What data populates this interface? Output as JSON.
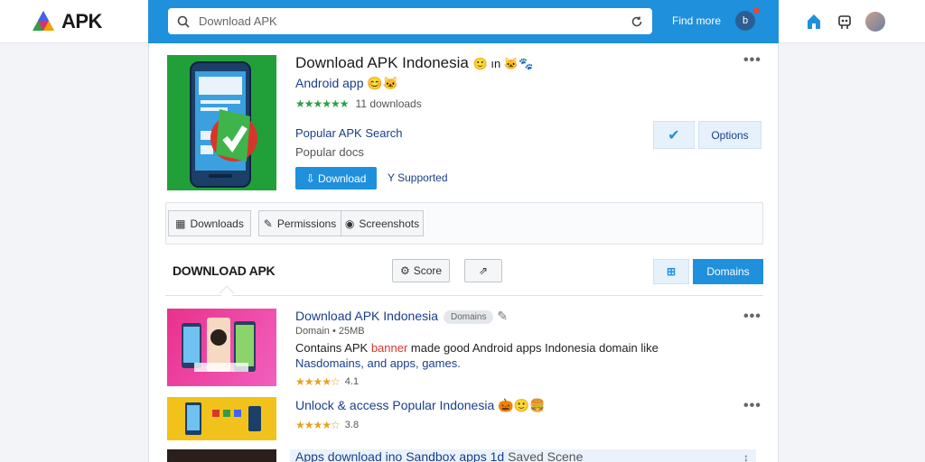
{
  "brand": {
    "name": "APK"
  },
  "search": {
    "placeholder": "Download APK"
  },
  "topbar": {
    "link_label": "Find more",
    "avatar_initial": "b"
  },
  "hero": {
    "title": "Download APK Indonesia",
    "title_extra": "🙂 ın 🐱🐾",
    "subtitle": "Android app 😊🐱",
    "rating_count": "11 downloads",
    "line1": "Popular APK Search",
    "line2": "Popular docs",
    "download_label": "⇩ Download",
    "supported_label": "Y Supported",
    "check_label": "✔",
    "options_label": "Options"
  },
  "toolbar": {
    "downloads_label": "Downloads",
    "permissions_label": "Permissions",
    "screenshots_label": "Screenshots"
  },
  "section": {
    "title": "DOWNLOAD APK",
    "sort_label": "Score",
    "share_label": "⇗",
    "grid_label": "⊞",
    "domains_label": "Domains"
  },
  "items": [
    {
      "title": "Download APK Indonesia",
      "badge": "Domains",
      "meta": "Domain • 25MB",
      "desc_a": "Contains APK ",
      "desc_hl": "banner",
      "desc_b": " made good Android apps Indonesia domain like",
      "desc_line2": "Nasdomains, and apps, games.",
      "rating": "4.1"
    },
    {
      "title": "Unlock & access Popular Indonesia",
      "title_extra": "🎃🙂🍔",
      "rating": "3.8"
    },
    {
      "title": "Apps download ino Sandbox apps 1d",
      "title_extra": "Saved Scene"
    }
  ],
  "colors": {
    "accent": "#1f90dc",
    "star_green": "#2aa147",
    "star_gold": "#e8a221"
  }
}
